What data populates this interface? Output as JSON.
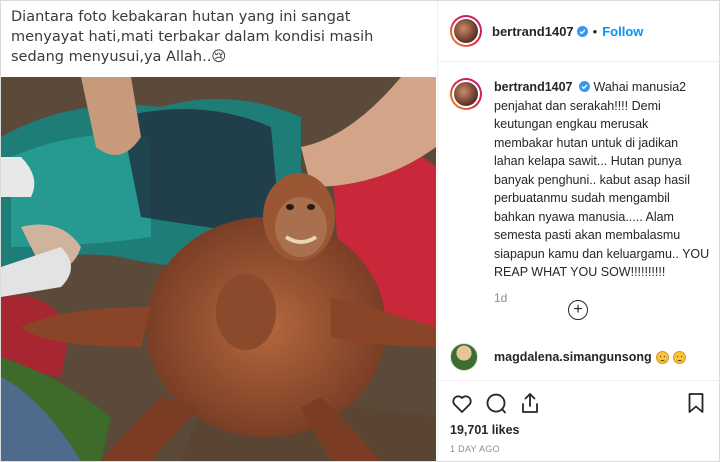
{
  "post": {
    "overlay_caption": "Diantara foto kebakaran hutan yang ini sangat menyayat hati,mati terbakar dalam kondisi masih sedang menyusui,ya Allah..😢",
    "image_alt": "orangutan photo"
  },
  "header": {
    "username": "bertrand1407",
    "separator": "•",
    "follow_label": "Follow"
  },
  "main_comment": {
    "username": "bertrand1407",
    "text": "Wahai manusia2 penjahat dan serakah!!!! Demi keutungan engkau merusak membakar hutan untuk di jadikan lahan kelapa sawit... Hutan punya banyak penghuni.. kabut asap hasil perbuatanmu sudah mengambil bahkan nyawa manusia..... Alam semesta pasti akan membalasmu siapapun kamu dan keluargamu.. YOU REAP WHAT YOU SOW!!!!!!!!!!",
    "time": "1d"
  },
  "load_more_symbol": "+",
  "comment2": {
    "username": "magdalena.simangunsong"
  },
  "actions": {
    "likes": "19,701 likes",
    "timestamp": "1 DAY AGO"
  },
  "colors": {
    "accent": "#0095f6",
    "text": "#262626",
    "muted": "#8e8e8e",
    "border": "#efefef"
  },
  "icons": [
    "verified-badge-icon",
    "heart-icon",
    "comment-icon",
    "share-icon",
    "bookmark-icon",
    "add-circle-icon",
    "sad-emoji-icon"
  ]
}
